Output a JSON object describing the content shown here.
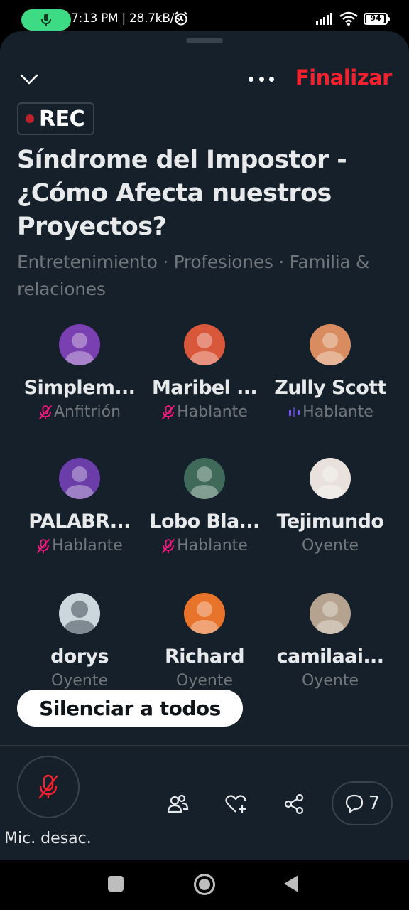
{
  "status_bar": {
    "text": "7:13 PM | 28.7kB/s",
    "battery": "94",
    "battery_level": 0.94
  },
  "header": {
    "end_label": "Finalizar"
  },
  "recording": {
    "label": "REC"
  },
  "space": {
    "title": "Síndrome del Impostor - ¿Cómo Afecta nuestros Proyectos?",
    "topics": "Entretenimiento · Profesiones · Familia & relaciones"
  },
  "participants": [
    {
      "name": "Simplem...",
      "role": "Anfitrión",
      "mic": "muted",
      "avatar_color": "#7a3fb0"
    },
    {
      "name": "Maribel ...",
      "role": "Hablante",
      "mic": "muted",
      "avatar_color": "#d9583b"
    },
    {
      "name": "Zully Scott",
      "role": "Hablante",
      "mic": "speaking",
      "avatar_color": "#d98c5f"
    },
    {
      "name": "PALABR...",
      "role": "Hablante",
      "mic": "muted",
      "avatar_color": "#6a3da8"
    },
    {
      "name": "Lobo Bla...",
      "role": "Hablante",
      "mic": "muted",
      "avatar_color": "#3f6a5a"
    },
    {
      "name": "Tejimundo",
      "role": "Oyente",
      "mic": "none",
      "avatar_color": "#e9e2dc"
    },
    {
      "name": "dorys",
      "role": "Oyente",
      "mic": "none",
      "avatar_color": "#ccd6dd"
    },
    {
      "name": "Richard",
      "role": "Oyente",
      "mic": "none",
      "avatar_color": "#e8742c"
    },
    {
      "name": "camilaai...",
      "role": "Oyente",
      "mic": "none",
      "avatar_color": "#b6a38f"
    }
  ],
  "mute_all_label": "Silenciar a todos",
  "bottom_bar": {
    "mic_label": "Mic. desac.",
    "comments_count": "7"
  },
  "colors": {
    "background": "#15202b",
    "accent_red": "#f4212e",
    "muted_icon": "#f91880",
    "speaking_icon": "#7856ff",
    "secondary_text": "#71767b"
  }
}
